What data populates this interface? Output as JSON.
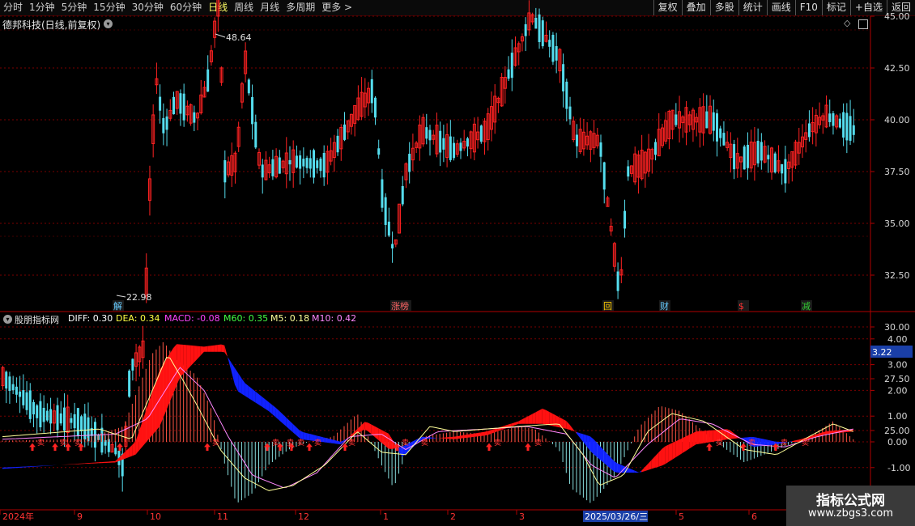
{
  "topbar": {
    "period_tabs": [
      "分时",
      "1分钟",
      "5分钟",
      "15分钟",
      "30分钟",
      "60分钟",
      "日线",
      "周线",
      "月线",
      "多周期",
      "更多 >"
    ],
    "active_tab": "日线",
    "tools": [
      "复权",
      "叠加",
      "多股",
      "统计",
      "画线",
      "F10",
      "标记",
      "+自选",
      "返回"
    ]
  },
  "main_chart": {
    "title": "德邦科技(日线,前复权)",
    "high_label": "48.64",
    "low_label": "22.98",
    "price_axis": [
      "45.00",
      "42.50",
      "40.00",
      "37.50",
      "35.00",
      "32.50",
      "30.00",
      "27.50",
      "25.00"
    ],
    "event_markers": [
      {
        "text": "解",
        "color": "#66ccff"
      },
      {
        "text": "涨榜",
        "color": "#ff6666"
      },
      {
        "text": "回",
        "color": "#ffcc00"
      },
      {
        "text": "财",
        "color": "#66ccff"
      },
      {
        "text": "$",
        "color": "#ff3333"
      },
      {
        "text": "减",
        "color": "#33cc33"
      }
    ],
    "colors": {
      "up": "#ff2222",
      "down": "#55ddee"
    }
  },
  "indicator": {
    "name": "股朋指标网",
    "values": [
      {
        "label": "DIFF: 0.30",
        "color": "#ffffff"
      },
      {
        "label": "DEA: 0.34",
        "color": "#ffff44"
      },
      {
        "label": "MACD: -0.08",
        "color": "#ff44ff"
      },
      {
        "label": "M60: 0.35",
        "color": "#44ff44"
      },
      {
        "label": "M5: 0.18",
        "color": "#ffff99"
      },
      {
        "label": "M10: 0.42",
        "color": "#ff88ff"
      }
    ],
    "axis": [
      "4.00",
      "3.00",
      "2.00",
      "1.00",
      "0.00",
      "-1.00"
    ],
    "current_value": "3.22",
    "markers": [
      "买",
      "买",
      "买",
      "买",
      "买",
      "买",
      "买",
      "卖",
      "卖",
      "卖",
      "卖",
      "卖",
      "卖",
      "卖",
      "卖",
      "卖",
      "卖",
      "卖",
      "卖",
      "卖",
      "卖",
      "卖",
      "卖",
      "卖"
    ]
  },
  "time_axis": {
    "labels": [
      "2024年",
      "9",
      "10",
      "11",
      "12",
      "1",
      "2",
      "3",
      "2025/03/26/三",
      "5",
      "6"
    ],
    "highlight": "2025/03/26/三"
  },
  "watermark": {
    "line1": "指标公式网",
    "line2": "www.zbgs3.com"
  }
}
